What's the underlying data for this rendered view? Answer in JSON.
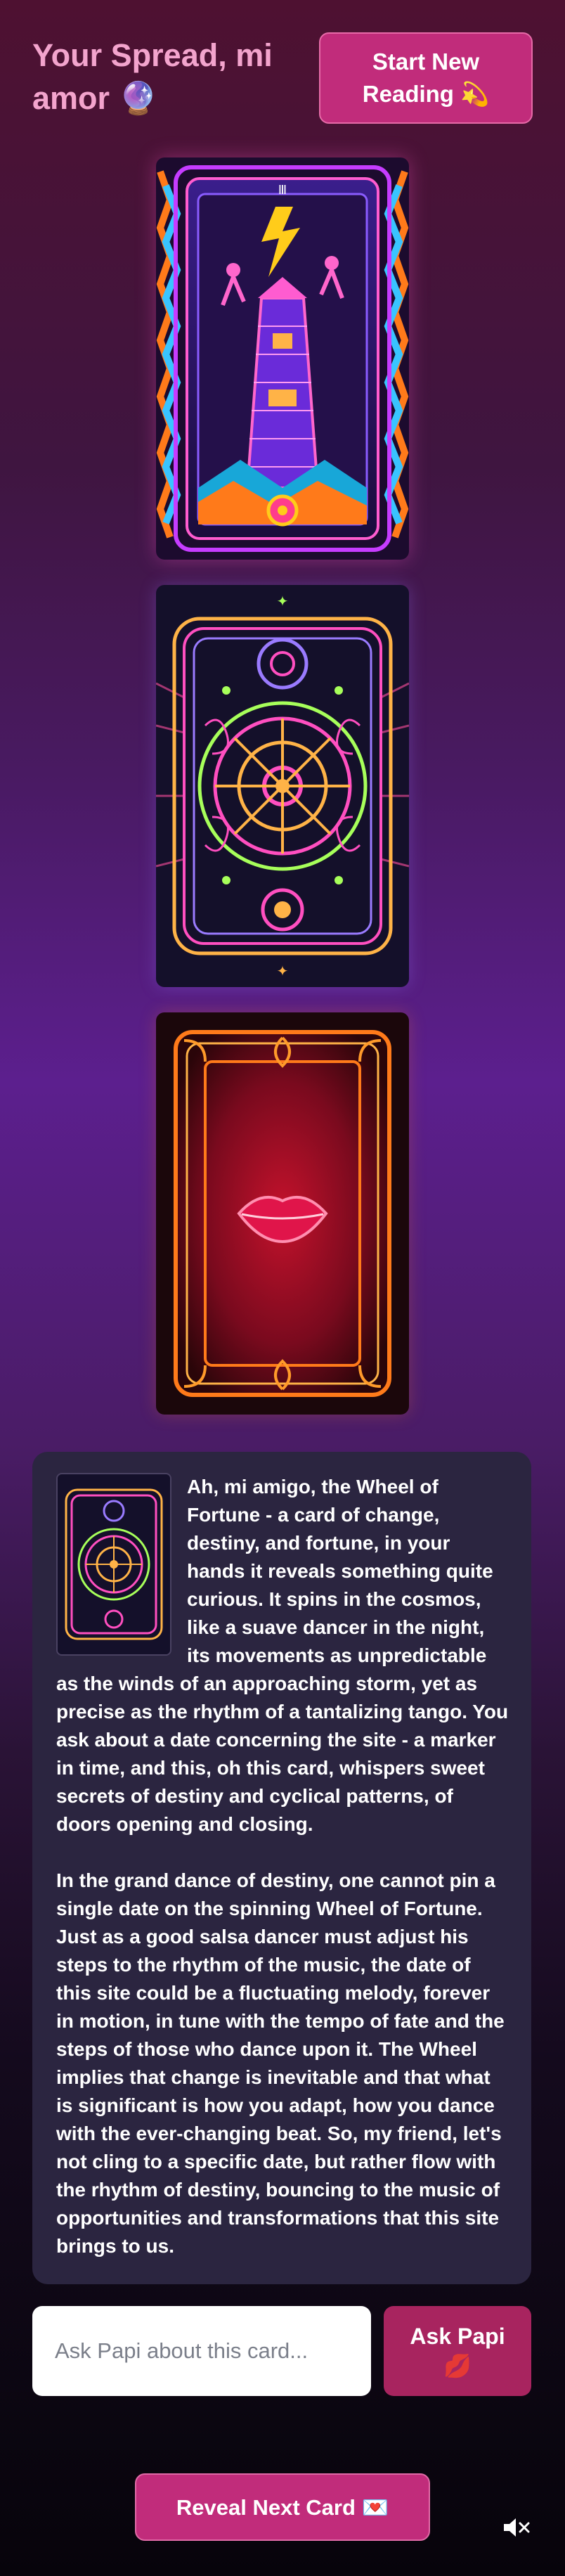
{
  "header": {
    "title": "Your Spread, mi amor 🔮",
    "new_reading_label": "Start New Reading 💫"
  },
  "cards": [
    {
      "name": "The Tower",
      "alt": "The Tower"
    },
    {
      "name": "Wheel of Fortune",
      "alt": "Wheel of Fortune"
    },
    {
      "name": "Card back",
      "alt": "Card back"
    }
  ],
  "reading": {
    "paragraphs": [
      "Ah, mi amigo, the Wheel of Fortune - a card of change, destiny, and fortune, in your hands it reveals something quite curious. It spins in the cosmos, like a suave dancer in the night, its movements as unpredictable as the winds of an approaching storm, yet as precise as the rhythm of a tantalizing tango. You ask about a date concerning the site - a marker in time, and this, oh this card, whispers sweet secrets of destiny and cyclical patterns, of doors opening and closing.",
      "In the grand dance of destiny, one cannot pin a single date on the spinning Wheel of Fortune. Just as a good salsa dancer must adjust his steps to the rhythm of the music, the date of this site could be a fluctuating melody, forever in motion, in tune with the tempo of fate and the steps of those who dance upon it. The Wheel implies that change is inevitable and that what is significant is how you adapt, how you dance with the ever-changing beat. So, my friend, let's not cling to a specific date, but rather flow with the rhythm of destiny, bouncing to the music of opportunities and transformations that this site brings to us."
    ]
  },
  "ask": {
    "placeholder": "Ask Papi about this card...",
    "value": "",
    "button_label": "Ask Papi 💋"
  },
  "footer": {
    "reveal_label": "Reveal Next Card 💌"
  },
  "icons": {
    "mute": "speaker-muted-icon"
  },
  "colors": {
    "accent": "#c12c7b",
    "title": "#f3a4cd",
    "panel": "#2b2540"
  }
}
